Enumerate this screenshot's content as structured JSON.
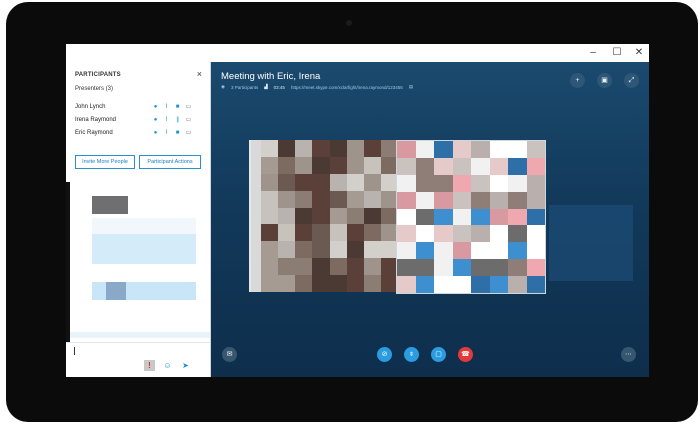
{
  "window": {
    "minimize_glyph": "–",
    "maximize_glyph": "☐",
    "close_glyph": "✕"
  },
  "participants_panel": {
    "title": "PARTICIPANTS",
    "close_glyph": "×",
    "presenters_label": "Presenters (3)",
    "participants": [
      {
        "name": "John Lynch"
      },
      {
        "name": "Irena Raymond"
      },
      {
        "name": "Eric Raymond"
      }
    ],
    "invite_button": "Invite More People",
    "actions_button": "Participant Actions"
  },
  "meeting": {
    "title": "Meeting with Eric, Irena",
    "participants_count": "3 Participants",
    "duration": "03:45",
    "link": "https://meet.skype.com/xclarfight/irena.raymond/123456"
  },
  "icons": {
    "chat": "chat-icon",
    "mic": "microphone-icon",
    "video": "video-icon",
    "screen": "screen-share-icon",
    "hangup": "hang-up-icon",
    "more": "more-options-icon",
    "add_person": "add-person-icon",
    "layout": "layout-icon",
    "fullscreen": "fullscreen-icon",
    "emoji": "emoji-icon",
    "send": "send-icon",
    "important": "important-icon"
  },
  "colors": {
    "accent": "#1a8fd6",
    "stage_top": "#1a4a6e",
    "stage_bottom": "#0e2e4c",
    "hangup": "#e5383b",
    "control": "#2b9ce0"
  }
}
